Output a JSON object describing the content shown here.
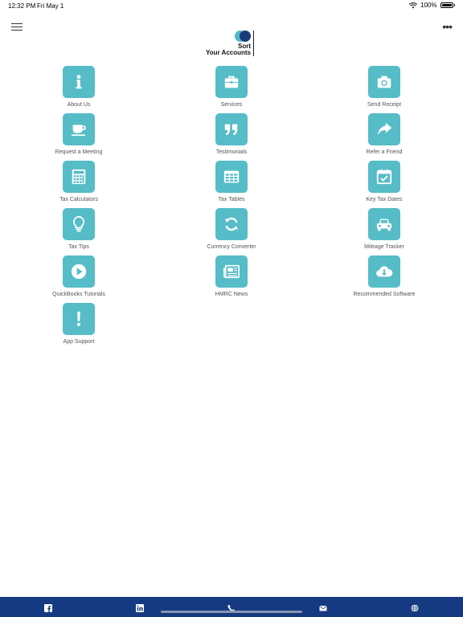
{
  "status": {
    "time": "12:32 PM",
    "date": "Fri May 1",
    "battery": "100%"
  },
  "logo": {
    "line1": "Sort",
    "line2": "Your Accounts"
  },
  "tiles": [
    {
      "label": "About Us",
      "icon": "info-icon"
    },
    {
      "label": "Services",
      "icon": "briefcase-icon"
    },
    {
      "label": "Send Receipt",
      "icon": "camera-icon"
    },
    {
      "label": "Request a Meeting",
      "icon": "coffee-cup-icon"
    },
    {
      "label": "Testimonials",
      "icon": "quote-icon"
    },
    {
      "label": "Refer a Friend",
      "icon": "share-arrow-icon"
    },
    {
      "label": "Tax Calculators",
      "icon": "calculator-icon"
    },
    {
      "label": "Tax Tables",
      "icon": "table-icon"
    },
    {
      "label": "Key Tax Dates",
      "icon": "calendar-check-icon"
    },
    {
      "label": "Tax Tips",
      "icon": "lightbulb-icon"
    },
    {
      "label": "Currency Converter",
      "icon": "refresh-icon"
    },
    {
      "label": "Mileage Tracker",
      "icon": "car-icon"
    },
    {
      "label": "QuickBooks Tutorials",
      "icon": "play-icon"
    },
    {
      "label": "HMRC News",
      "icon": "newspaper-icon"
    },
    {
      "label": "Recommended Software",
      "icon": "cloud-download-icon"
    },
    {
      "label": "App Support",
      "icon": "exclamation-icon"
    }
  ],
  "bottom_nav": [
    {
      "icon": "facebook-icon"
    },
    {
      "icon": "linkedin-icon"
    },
    {
      "icon": "phone-icon"
    },
    {
      "icon": "mail-icon"
    },
    {
      "icon": "globe-icon"
    }
  ],
  "colors": {
    "tile": "#56bcc7",
    "bottom_bar": "#163a82",
    "logo_teal": "#4fb9c6",
    "logo_navy": "#1a3a7a"
  }
}
